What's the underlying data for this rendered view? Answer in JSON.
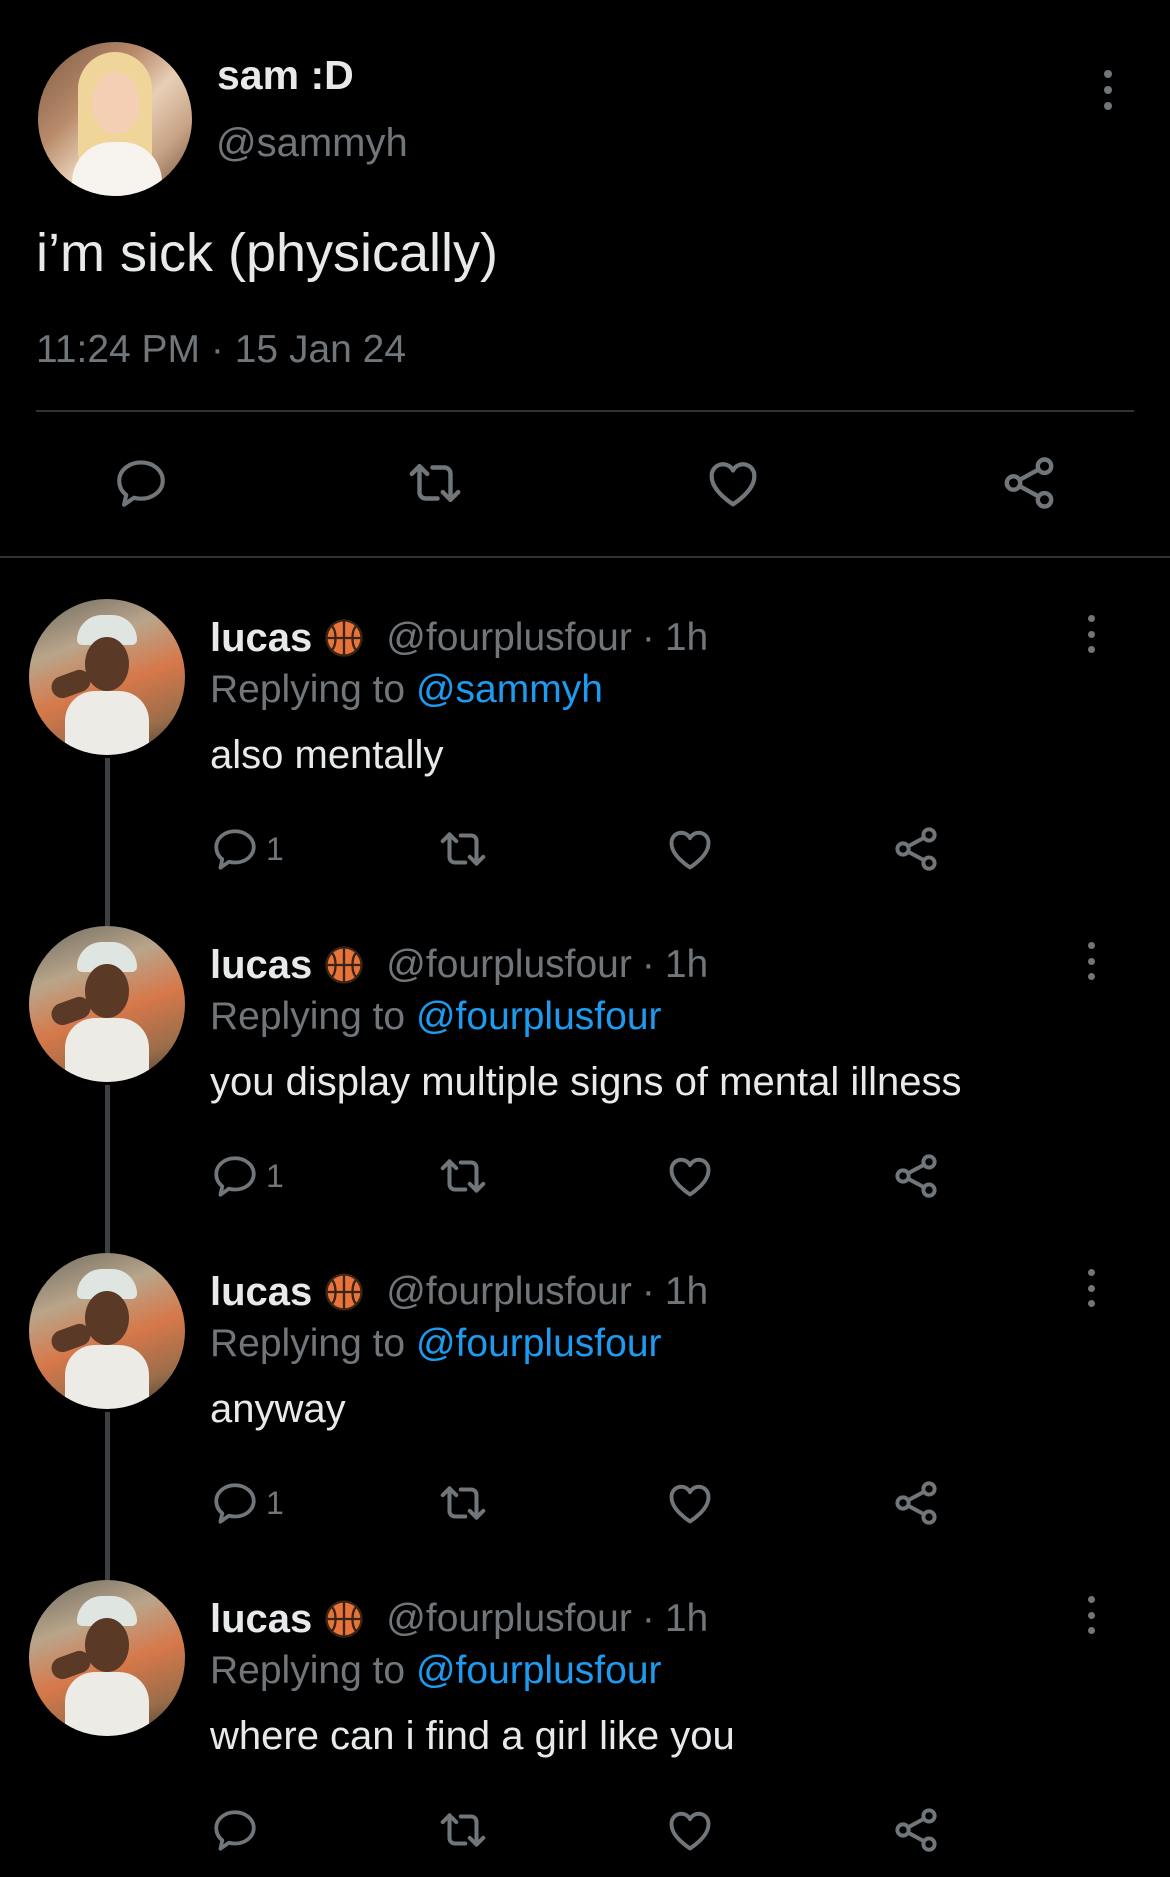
{
  "main_tweet": {
    "display_name": "sam :D",
    "handle": "@sammyh",
    "text": "i’m sick (physically)",
    "time": "11:24 PM",
    "dot": "·",
    "date": "15 Jan 24"
  },
  "replies": [
    {
      "display_name": "lucas",
      "emoji_icon": "basketball-icon",
      "handle": "@fourplusfour",
      "dot": "·",
      "age": "1h",
      "replying_prefix": "Replying to ",
      "replying_to": "@sammyh",
      "text": "also mentally",
      "reply_count": "1"
    },
    {
      "display_name": "lucas",
      "emoji_icon": "basketball-icon",
      "handle": "@fourplusfour",
      "dot": "·",
      "age": "1h",
      "replying_prefix": "Replying to ",
      "replying_to": "@fourplusfour",
      "text": "you display multiple signs of mental illness",
      "reply_count": "1"
    },
    {
      "display_name": "lucas",
      "emoji_icon": "basketball-icon",
      "handle": "@fourplusfour",
      "dot": "·",
      "age": "1h",
      "replying_prefix": "Replying to ",
      "replying_to": "@fourplusfour",
      "text": "anyway",
      "reply_count": "1"
    },
    {
      "display_name": "lucas",
      "emoji_icon": "basketball-icon",
      "handle": "@fourplusfour",
      "dot": "·",
      "age": "1h",
      "replying_prefix": "Replying to ",
      "replying_to": "@fourplusfour",
      "text": "where can i find a girl like you",
      "reply_count": ""
    }
  ],
  "colors": {
    "background": "#000000",
    "text_primary": "#e7e9ea",
    "text_secondary": "#71767b",
    "link": "#1d9bf0",
    "divider": "#2f3336"
  },
  "icons": [
    "more-icon",
    "reply-icon",
    "retweet-icon",
    "like-icon",
    "share-icon",
    "basketball-icon"
  ]
}
